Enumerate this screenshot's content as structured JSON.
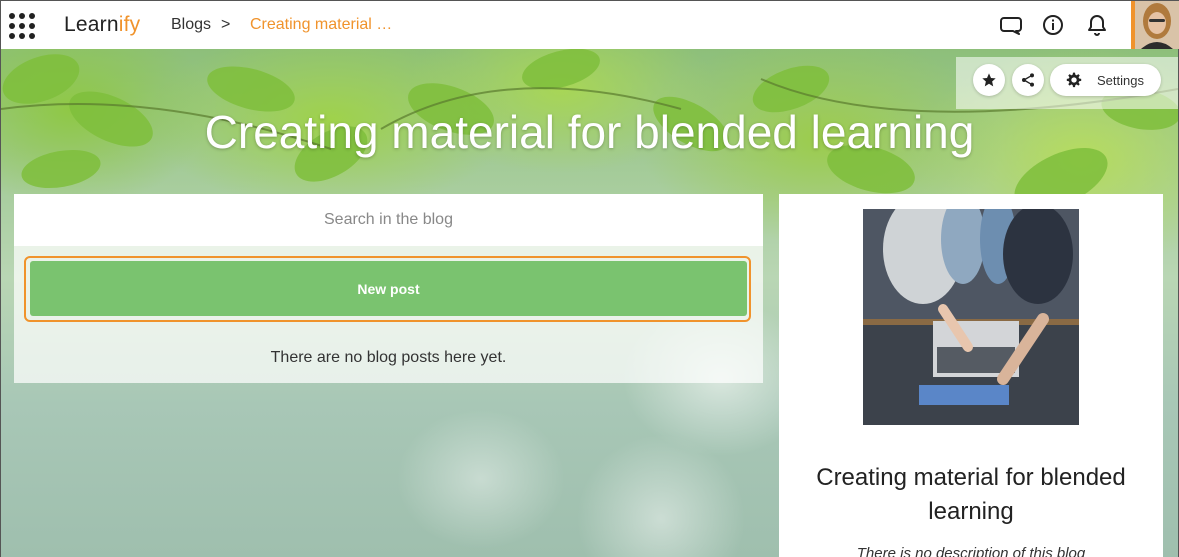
{
  "topbar": {
    "logo_main": "Learn",
    "logo_accent": "ify",
    "breadcrumb_blogs": "Blogs",
    "breadcrumb_sep": ">",
    "breadcrumb_current": "Creating material …",
    "icons": [
      "apps-grid-icon",
      "chat-icon",
      "info-icon",
      "bell-icon"
    ],
    "accent_color": "#f0932c"
  },
  "hero": {
    "title": "Creating material for blended learning"
  },
  "actions": {
    "settings_label": "Settings",
    "icons": [
      "star-icon",
      "share-icon",
      "gear-icon"
    ]
  },
  "blog": {
    "search_placeholder": "Search in the blog",
    "new_post_label": "New post",
    "empty_message": "There are no blog posts here yet.",
    "new_post_color": "#7ac36f"
  },
  "sidebar": {
    "title": "Creating material for blended learning",
    "description": "There is no description of this blog"
  }
}
